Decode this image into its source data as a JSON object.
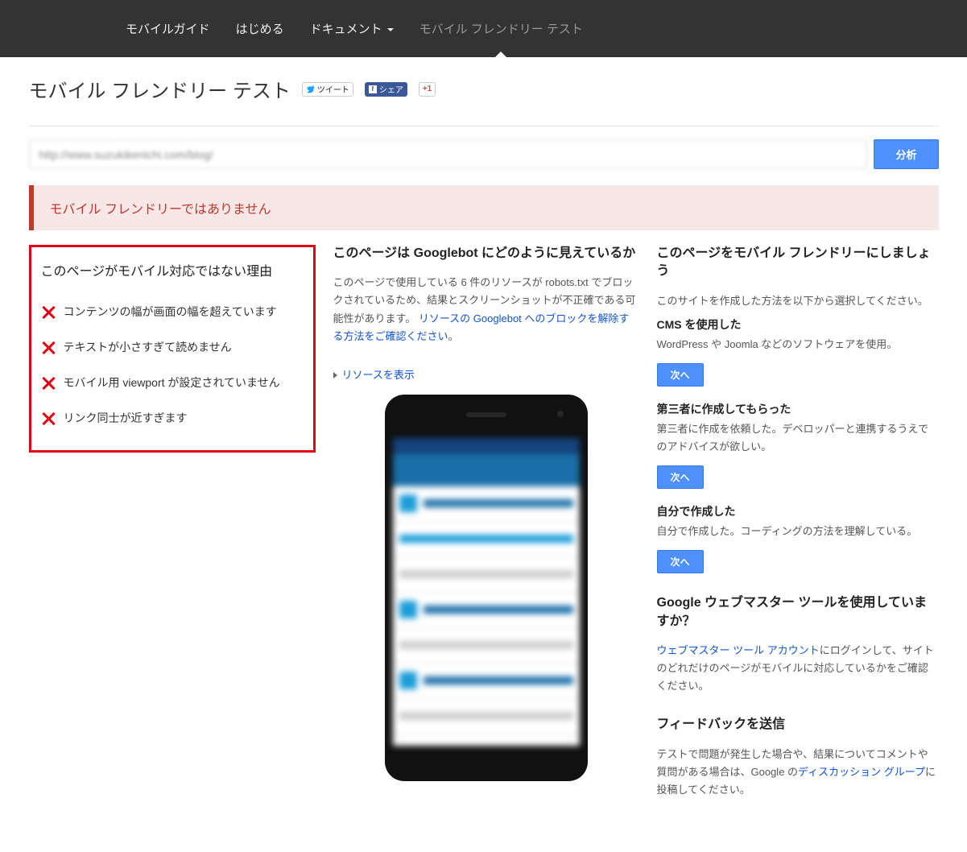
{
  "nav": {
    "items": [
      {
        "label": "モバイルガイド"
      },
      {
        "label": "はじめる"
      },
      {
        "label": "ドキュメント",
        "dropdown": true
      },
      {
        "label": "モバイル フレンドリー テスト",
        "active": true
      }
    ]
  },
  "page_title": "モバイル フレンドリー テスト",
  "social": {
    "tweet": "ツイート",
    "share": "シェア",
    "gplus": "+1"
  },
  "url_input": {
    "value": "http://www.suzukikenichi.com/blog/",
    "button": "分析"
  },
  "alert": "モバイル フレンドリーではありません",
  "reasons": {
    "title": "このページがモバイル対応ではない理由",
    "items": [
      "コンテンツの幅が画面の幅を超えています",
      "テキストが小さすぎて読めません",
      "モバイル用 viewport が設定されていません",
      "リンク同士が近すぎます"
    ]
  },
  "googlebot": {
    "title": "このページは Googlebot にどのように見えているか",
    "body_pre": "このページで使用している 6 件のリソースが robots.txt でブロックされているため、結果とスクリーンショットが不正確である可能性があります。",
    "link": "リソースの Googlebot へのブロックを解除する方法をご確認ください",
    "body_post": "。",
    "toggle": "リソースを表示"
  },
  "fix": {
    "title": "このページをモバイル フレンドリーにしましょう",
    "intro": "このサイトを作成した方法を以下から選択してください。",
    "options": [
      {
        "heading": "CMS を使用した",
        "desc": "WordPress や Joomla などのソフトウェアを使用。",
        "button": "次へ"
      },
      {
        "heading": "第三者に作成してもらった",
        "desc": "第三者に作成を依頼した。デベロッパーと連携するうえでのアドバイスが欲しい。",
        "button": "次へ"
      },
      {
        "heading": "自分で作成した",
        "desc": "自分で作成した。コーディングの方法を理解している。",
        "button": "次へ"
      }
    ]
  },
  "wmt": {
    "title": "Google ウェブマスター ツールを使用していますか？",
    "link": "ウェブマスター ツール アカウント",
    "rest": "にログインして、サイトのどれだけのページがモバイルに対応しているかをご確認ください。"
  },
  "feedback": {
    "title": "フィードバックを送信",
    "pre": "テストで問題が発生した場合や、結果についてコメントや質問がある場合は、Google の",
    "link": "ディスカッション グループ",
    "post": "に投稿してください。"
  }
}
